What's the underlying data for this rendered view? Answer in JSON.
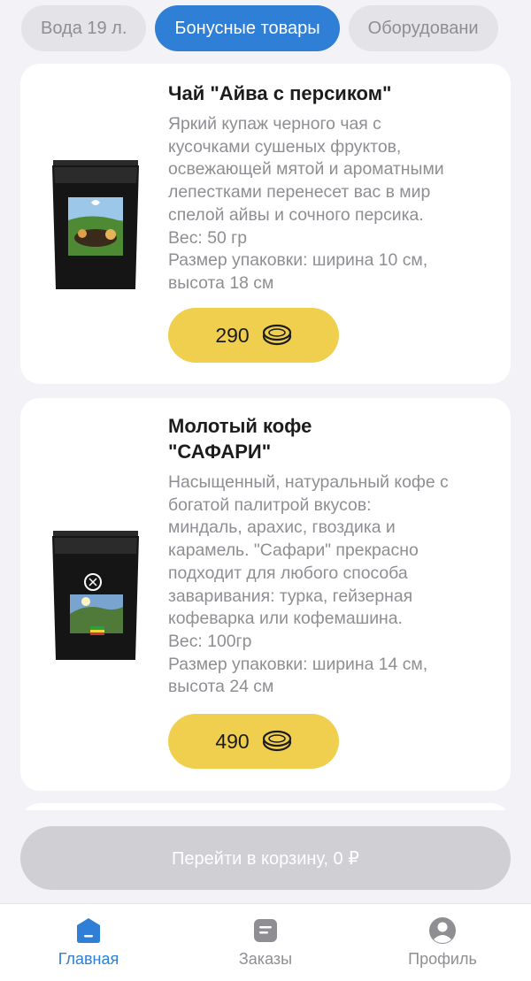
{
  "categories": [
    {
      "label": "Вода 19 л.",
      "active": false
    },
    {
      "label": "Бонусные товары",
      "active": true
    },
    {
      "label": "Оборудовани",
      "active": false
    }
  ],
  "products": [
    {
      "title_lines": [
        "Чай \"Айва с персиком\""
      ],
      "description_lines": [
        "Яркий купаж черного чая с",
        "кусочками сушеных фруктов,",
        "освежающей мятой и ароматными",
        "лепестками перенесет вас в мир",
        "спелой айвы и сочного персика.",
        "Вес: 50 гр",
        "Размер упаковки: ширина 10 см,",
        "высота 18 см"
      ],
      "price": "290",
      "image_icon": "tea-package-image"
    },
    {
      "title_lines": [
        "Молотый кофе",
        "\"САФАРИ\""
      ],
      "description_lines": [
        "Насыщенный, натуральный кофе с",
        "богатой палитрой вкусов:",
        "миндаль, арахис,  гвоздика и",
        "карамель. \"Сафари\" прекрасно",
        "подходит для любого способа",
        "заваривания: турка, гейзерная",
        "кофеварка или кофемашина.",
        "Вес: 100гр",
        "Размер упаковки: ширина 14 см,",
        "высота 24 см"
      ],
      "price": "490",
      "image_icon": "coffee-package-image"
    }
  ],
  "cart": {
    "label": "Перейти в корзину, 0 ₽"
  },
  "tabbar": {
    "items": [
      {
        "label": "Главная",
        "icon": "home-icon",
        "active": true
      },
      {
        "label": "Заказы",
        "icon": "orders-icon",
        "active": false
      },
      {
        "label": "Профиль",
        "icon": "profile-icon",
        "active": false
      }
    ]
  },
  "colors": {
    "accent": "#2f7fd6",
    "price_button": "#f0cf4e",
    "inactive_chip": "#e3e3e8",
    "cart_disabled": "#cfcfd4"
  }
}
